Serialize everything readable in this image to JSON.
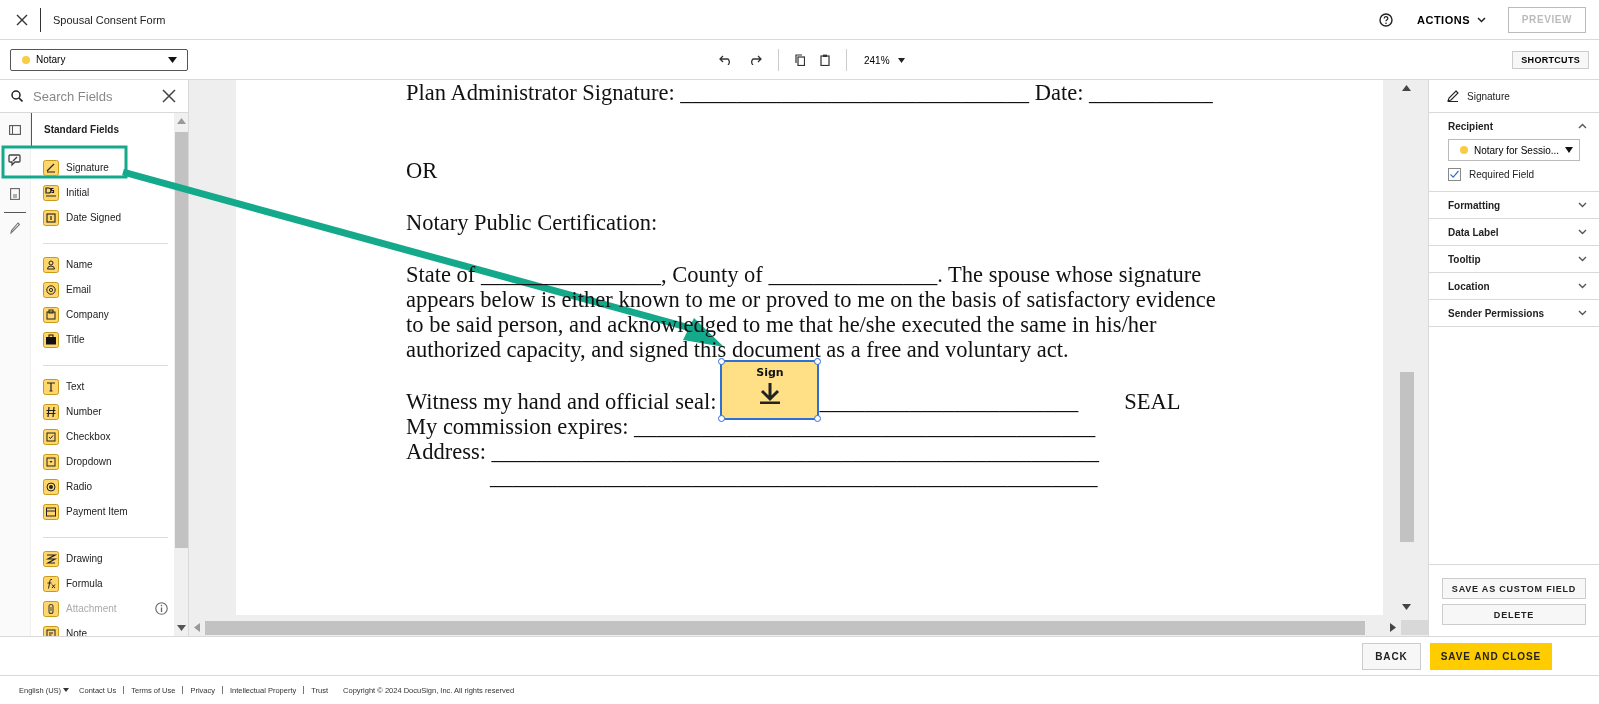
{
  "header": {
    "title": "Spousal Consent Form",
    "actions": "ACTIONS",
    "preview": {
      "label": "PREVIEW",
      "disabled": true
    }
  },
  "toolbar": {
    "recipient": {
      "name": "Notary",
      "color": "#f8cd46"
    },
    "zoom": "241%",
    "shortcuts": "SHORTCUTS"
  },
  "field_panel": {
    "search_placeholder": "Search Fields",
    "heading": "Standard Fields",
    "groups": [
      [
        {
          "label": "Signature",
          "kind": "signature",
          "disabled": false
        },
        {
          "label": "Initial",
          "kind": "initial",
          "disabled": false
        },
        {
          "label": "Date Signed",
          "kind": "date",
          "disabled": false
        }
      ],
      [
        {
          "label": "Name",
          "kind": "person",
          "disabled": false
        },
        {
          "label": "Email",
          "kind": "email",
          "disabled": false
        },
        {
          "label": "Company",
          "kind": "company",
          "disabled": false
        },
        {
          "label": "Title",
          "kind": "title",
          "disabled": false
        }
      ],
      [
        {
          "label": "Text",
          "kind": "text",
          "disabled": false
        },
        {
          "label": "Number",
          "kind": "number",
          "disabled": false
        },
        {
          "label": "Checkbox",
          "kind": "checkbox",
          "disabled": false
        },
        {
          "label": "Dropdown",
          "kind": "dropdown",
          "disabled": false
        },
        {
          "label": "Radio",
          "kind": "radio",
          "disabled": false
        },
        {
          "label": "Payment Item",
          "kind": "payment",
          "disabled": false
        }
      ],
      [
        {
          "label": "Drawing",
          "kind": "drawing",
          "disabled": false
        },
        {
          "label": "Formula",
          "kind": "formula",
          "disabled": false
        },
        {
          "label": "Attachment",
          "kind": "attachment",
          "disabled": true
        },
        {
          "label": "Note",
          "kind": "note",
          "disabled": false
        }
      ]
    ]
  },
  "document": {
    "paragraphs": [
      {
        "kind": "line",
        "text": "Plan Administrator Signature: _______________________________ Date: ___________"
      },
      {
        "kind": "line",
        "text": "OR"
      },
      {
        "kind": "line",
        "text": "Notary Public Certification:"
      },
      {
        "kind": "para",
        "text": "State of ________________, County of _______________. The spouse whose signature appears below is either known to me or proved to me on the basis of satisfactory evidence to be said person, and acknowledged to me that he/she executed the same in his/her authorized capacity, and signed this document as a free and voluntary act."
      },
      {
        "kind": "sealed",
        "text": "Witness my hand and official seal:",
        "blank": "_______________________",
        "extra": "SEAL"
      },
      {
        "kind": "line",
        "text": "My commission expires: _________________________________________"
      },
      {
        "kind": "line",
        "text": "Address: ______________________________________________________"
      },
      {
        "kind": "indent",
        "text": "______________________________________________________"
      }
    ]
  },
  "placed_field": {
    "label": "Sign",
    "selected": true
  },
  "properties": {
    "field": "Signature",
    "sections": [
      {
        "title": "Recipient",
        "expanded": true,
        "recipient": {
          "name": "Notary for Sessio...",
          "color": "#f8cd46"
        },
        "required": {
          "label": "Required Field",
          "checked": true
        }
      },
      {
        "title": "Formatting",
        "expanded": false
      },
      {
        "title": "Data Label",
        "expanded": false
      },
      {
        "title": "Tooltip",
        "expanded": false
      },
      {
        "title": "Location",
        "expanded": false
      },
      {
        "title": "Sender Permissions",
        "expanded": false
      }
    ],
    "buttons": [
      "SAVE AS CUSTOM FIELD",
      "DELETE"
    ]
  },
  "actions": [
    {
      "label": "BACK",
      "kind": "secondary"
    },
    {
      "label": "SAVE AND CLOSE",
      "kind": "primary"
    }
  ],
  "footer": {
    "language": "English (US)",
    "links": [
      "Contact Us",
      "Terms of Use",
      "Privacy",
      "Intellectual Property",
      "Trust"
    ],
    "copyright": "Copyright © 2024 DocuSign, Inc. All rights reserved"
  }
}
